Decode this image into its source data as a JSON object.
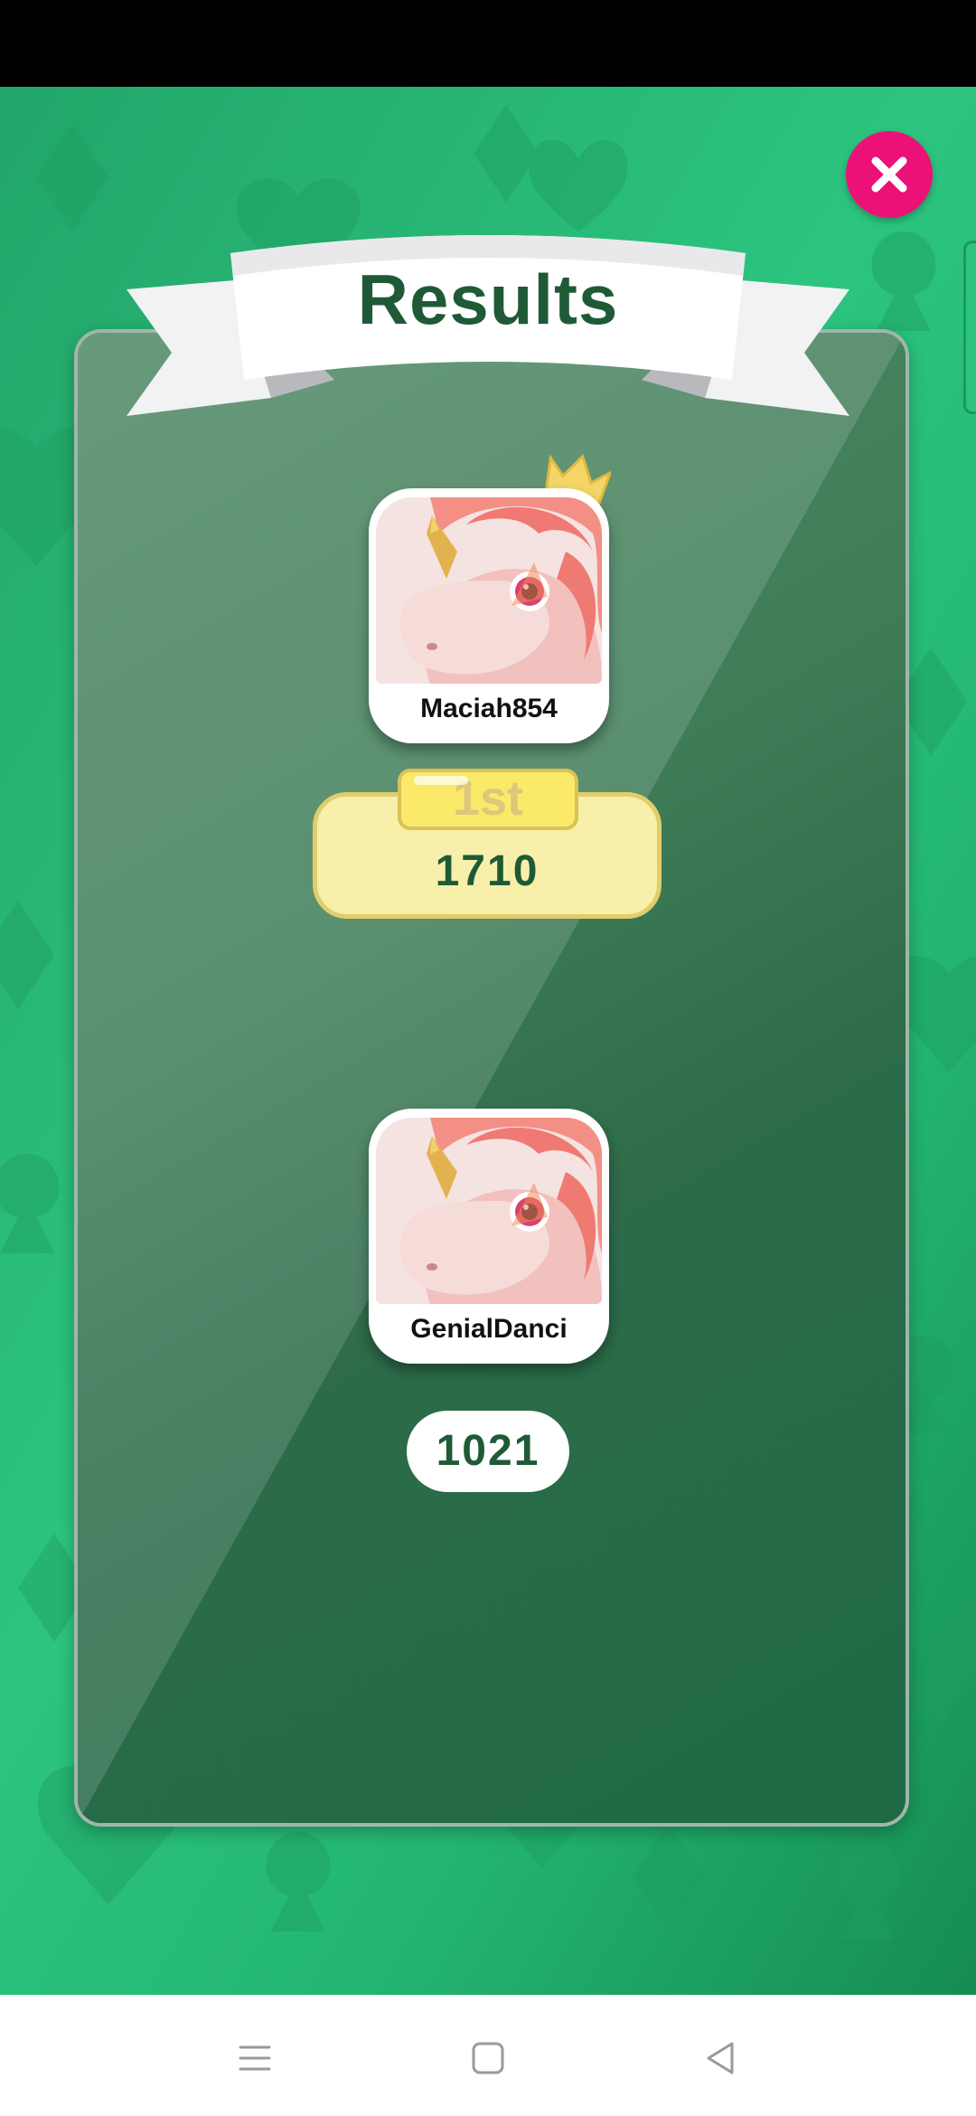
{
  "title": {
    "text": "Results"
  },
  "players": [
    {
      "name": "Maciah854",
      "rank": "1st",
      "score": "1710",
      "has_crown": true
    },
    {
      "name": "GenialDanci",
      "score": "1021"
    }
  ],
  "controls": {
    "close_icon": "close-icon"
  },
  "nav": {
    "menu_icon": "menu-icon",
    "home_icon": "home-icon",
    "back_icon": "back-icon"
  },
  "colors": {
    "background": "#2cc47f",
    "close": "#ec1176",
    "text_dark_green": "#1f5a36",
    "gold": "#f7efaa"
  }
}
